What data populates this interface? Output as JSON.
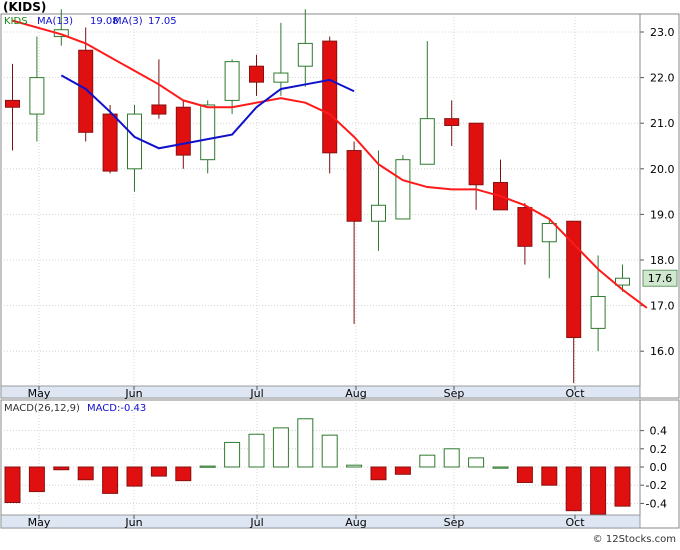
{
  "colors": {
    "bear_fill": "#e01010",
    "bull_fill": "#ffffff",
    "bull_edge": "#2f7a2f",
    "bear_edge": "#8a1010",
    "ma_slow": "#ff1a1a",
    "ma_fast": "#1111cc",
    "price_badge_bg": "#cfe8cf",
    "axis_band": "#dde6f2",
    "grid": "#cccccc"
  },
  "chart_data": [
    {
      "type": "candlestick",
      "title": "(KIDS)",
      "legend": [
        {
          "text": "KIDS",
          "color": "#1a8a1a"
        },
        {
          "text": "MA(13)",
          "color": "#1111cc"
        },
        {
          "text": "19.08",
          "color": "#1111cc"
        },
        {
          "text": "MA(3)",
          "color": "#1111cc"
        },
        {
          "text": "17.05",
          "color": "#1111cc"
        }
      ],
      "ylim": [
        15.0,
        23.8
      ],
      "yticks": [
        16.0,
        17.0,
        18.0,
        19.0,
        20.0,
        21.0,
        22.0,
        23.0
      ],
      "ytick_labels": [
        "16.0",
        "17.0",
        "18.0",
        "19.0",
        "20.0",
        "21.0",
        "22.0",
        "23.0"
      ],
      "x_month_labels": [
        "May",
        "Jun",
        "Jul",
        "Aug",
        "Sep",
        "Oct"
      ],
      "x_month_index": [
        1,
        5,
        10,
        14,
        18,
        23
      ],
      "last_price_label": "17.6",
      "last_price": 17.6,
      "ohlc": [
        {
          "o": 21.5,
          "h": 22.3,
          "l": 20.4,
          "c": 21.35
        },
        {
          "o": 21.2,
          "h": 22.9,
          "l": 20.6,
          "c": 22.0
        },
        {
          "o": 22.9,
          "h": 23.5,
          "l": 22.7,
          "c": 23.05
        },
        {
          "o": 22.6,
          "h": 23.1,
          "l": 20.6,
          "c": 20.8
        },
        {
          "o": 21.2,
          "h": 21.4,
          "l": 19.9,
          "c": 19.95
        },
        {
          "o": 20.0,
          "h": 21.4,
          "l": 19.5,
          "c": 21.2
        },
        {
          "o": 21.4,
          "h": 22.4,
          "l": 21.1,
          "c": 21.2
        },
        {
          "o": 21.35,
          "h": 21.5,
          "l": 20.0,
          "c": 20.3
        },
        {
          "o": 20.2,
          "h": 21.5,
          "l": 19.9,
          "c": 21.4
        },
        {
          "o": 21.5,
          "h": 22.4,
          "l": 21.2,
          "c": 22.35
        },
        {
          "o": 22.25,
          "h": 22.5,
          "l": 21.6,
          "c": 21.9
        },
        {
          "o": 21.9,
          "h": 23.2,
          "l": 21.6,
          "c": 22.1
        },
        {
          "o": 22.25,
          "h": 23.5,
          "l": 21.8,
          "c": 22.75
        },
        {
          "o": 22.8,
          "h": 22.9,
          "l": 19.9,
          "c": 20.35
        },
        {
          "o": 20.4,
          "h": 20.6,
          "l": 16.6,
          "c": 18.85
        },
        {
          "o": 18.85,
          "h": 20.4,
          "l": 18.2,
          "c": 19.2
        },
        {
          "o": 18.9,
          "h": 20.3,
          "l": 18.9,
          "c": 20.2
        },
        {
          "o": 20.1,
          "h": 22.8,
          "l": 20.1,
          "c": 21.1
        },
        {
          "o": 21.1,
          "h": 21.5,
          "l": 20.5,
          "c": 20.95
        },
        {
          "o": 21.0,
          "h": 21.0,
          "l": 19.1,
          "c": 19.65
        },
        {
          "o": 19.7,
          "h": 20.2,
          "l": 19.1,
          "c": 19.1
        },
        {
          "o": 19.15,
          "h": 19.25,
          "l": 17.9,
          "c": 18.3
        },
        {
          "o": 18.4,
          "h": 18.9,
          "l": 17.6,
          "c": 18.8
        },
        {
          "o": 18.85,
          "h": 18.85,
          "l": 15.3,
          "c": 16.3
        },
        {
          "o": 16.5,
          "h": 18.1,
          "l": 16.0,
          "c": 17.2
        },
        {
          "o": 17.45,
          "h": 17.9,
          "l": 17.3,
          "c": 17.6
        }
      ],
      "ma_slow": [
        23.25,
        23.1,
        22.95,
        22.75,
        22.45,
        22.15,
        21.85,
        21.5,
        21.35,
        21.35,
        21.45,
        21.55,
        21.45,
        21.2,
        20.7,
        20.1,
        19.75,
        19.6,
        19.55,
        19.55,
        19.4,
        19.2,
        18.9,
        18.35,
        17.8,
        17.35,
        16.95
      ],
      "ma_fast": [
        null,
        null,
        22.05,
        21.75,
        21.25,
        20.7,
        20.45,
        20.55,
        20.65,
        20.75,
        21.35,
        21.75,
        21.85,
        21.95,
        21.7,
        21.15,
        20.35,
        19.55,
        19.45,
        20.25,
        20.85,
        20.3,
        19.25,
        18.45,
        17.7,
        17.1,
        16.6
      ],
      "ma_fast_index": [
        null,
        null,
        2,
        3,
        4.8,
        5.8,
        6.8,
        7.8,
        8.8,
        9.5,
        10.5,
        11.5,
        12.4,
        null,
        null,
        null,
        null,
        null,
        null,
        null,
        null,
        null,
        null,
        null,
        null,
        null,
        null
      ]
    },
    {
      "type": "bar",
      "title": "MACD(26,12,9)",
      "legend": [
        {
          "text": "MACD(26,12,9)",
          "color": "#333333"
        },
        {
          "text": "MACD:-0.43",
          "color": "#1111cc"
        }
      ],
      "ylim": [
        -0.52,
        0.55
      ],
      "yticks": [
        0.4,
        0.2,
        0.0,
        -0.2,
        -0.4
      ],
      "ytick_labels": [
        "0.4",
        "0.2",
        "0.0",
        "-0.2",
        "-0.4"
      ],
      "x_month_labels": [
        "May",
        "Jun",
        "Jul",
        "Aug",
        "Sep",
        "Oct"
      ],
      "values": [
        -0.39,
        -0.27,
        -0.03,
        -0.14,
        -0.29,
        -0.21,
        -0.1,
        -0.15,
        0.01,
        0.27,
        0.36,
        0.43,
        0.53,
        0.35,
        0.02,
        -0.14,
        -0.08,
        0.13,
        0.2,
        0.1,
        0.0,
        -0.17,
        -0.2,
        -0.48,
        -0.52,
        -0.43
      ]
    }
  ]
}
